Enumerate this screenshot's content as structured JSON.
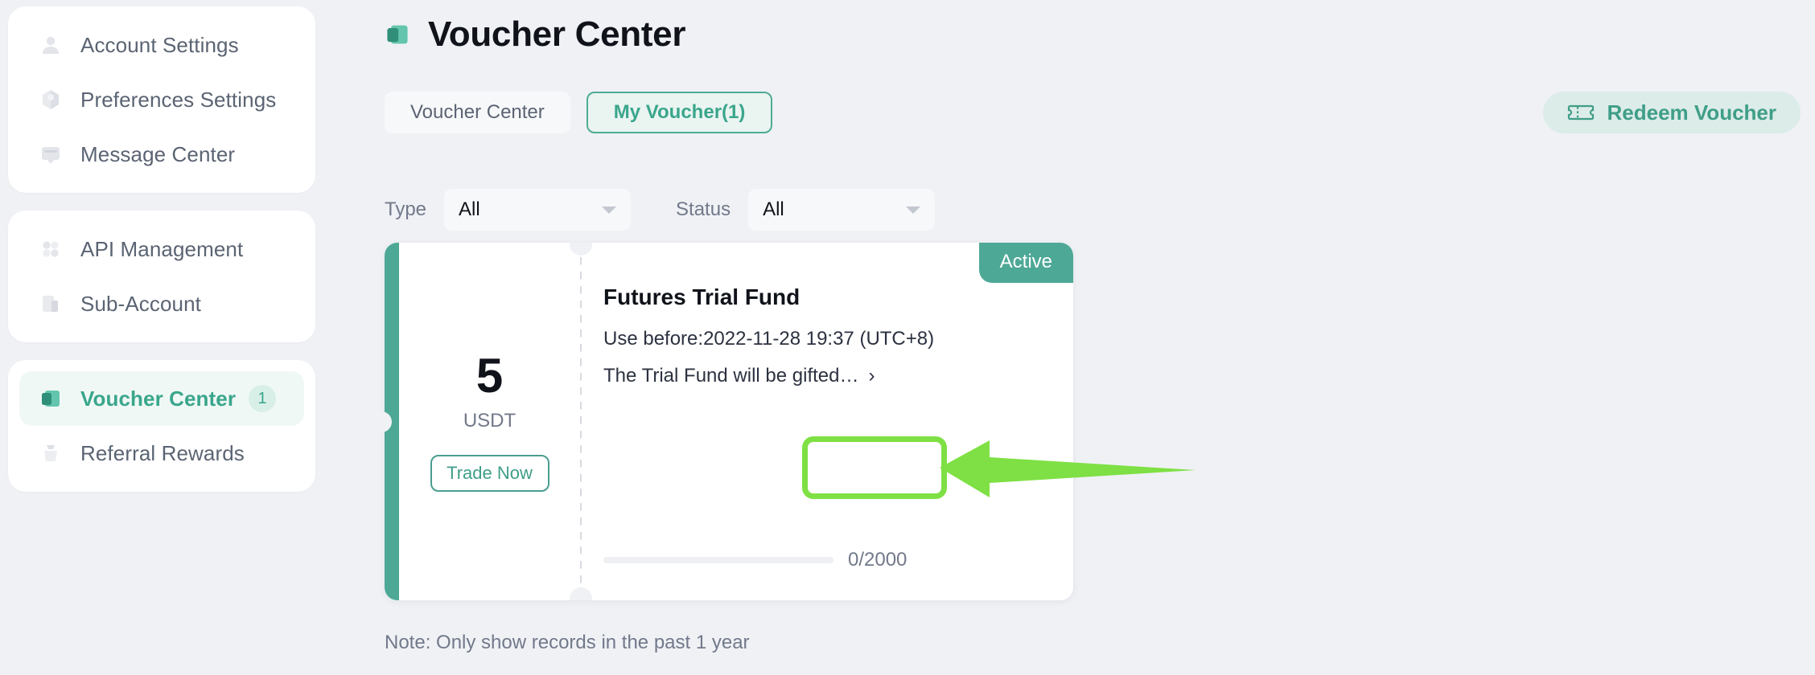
{
  "theme": {
    "background": "#eff1f5",
    "accent_teal": "#4ea896",
    "accent_green_highlight": "#7ee044",
    "text_primary": "#10131a",
    "text_muted": "#72798a"
  },
  "sidebar": {
    "groups": [
      {
        "items": [
          {
            "label": "Account Settings",
            "icon": "user-icon",
            "active": false
          },
          {
            "label": "Preferences Settings",
            "icon": "preferences-icon",
            "active": false
          },
          {
            "label": "Message Center",
            "icon": "message-icon",
            "active": false
          }
        ]
      },
      {
        "items": [
          {
            "label": "API Management",
            "icon": "api-icon",
            "active": false
          },
          {
            "label": "Sub-Account",
            "icon": "sub-account-icon",
            "active": false
          }
        ]
      },
      {
        "items": [
          {
            "label": "Voucher Center",
            "icon": "voucher-icon",
            "active": true,
            "badge": "1"
          },
          {
            "label": "Referral Rewards",
            "icon": "referral-icon",
            "active": false
          }
        ]
      }
    ]
  },
  "header": {
    "title": "Voucher Center",
    "icon": "voucher-icon"
  },
  "tabs": [
    {
      "label": "Voucher Center",
      "selected": false
    },
    {
      "label": "My Voucher(1)",
      "selected": true
    }
  ],
  "actions": {
    "redeem_label": "Redeem Voucher",
    "redeem_icon": "ticket-icon"
  },
  "filters": [
    {
      "label": "Type",
      "value": "All",
      "icon": "chevron-down-icon"
    },
    {
      "label": "Status",
      "value": "All",
      "icon": "chevron-down-icon"
    }
  ],
  "voucher": {
    "status_badge": "Active",
    "amount": "5",
    "currency": "USDT",
    "action_label": "Trade Now",
    "title": "Futures Trial Fund",
    "expiry": "Use before:2022-11-28 19:37 (UTC+8)",
    "description": "The Trial Fund will be gifted…",
    "description_arrow": "›",
    "progress_text": "0/2000",
    "progress_percent": 0
  },
  "footer": {
    "note": "Note: Only show records in the past 1 year"
  }
}
